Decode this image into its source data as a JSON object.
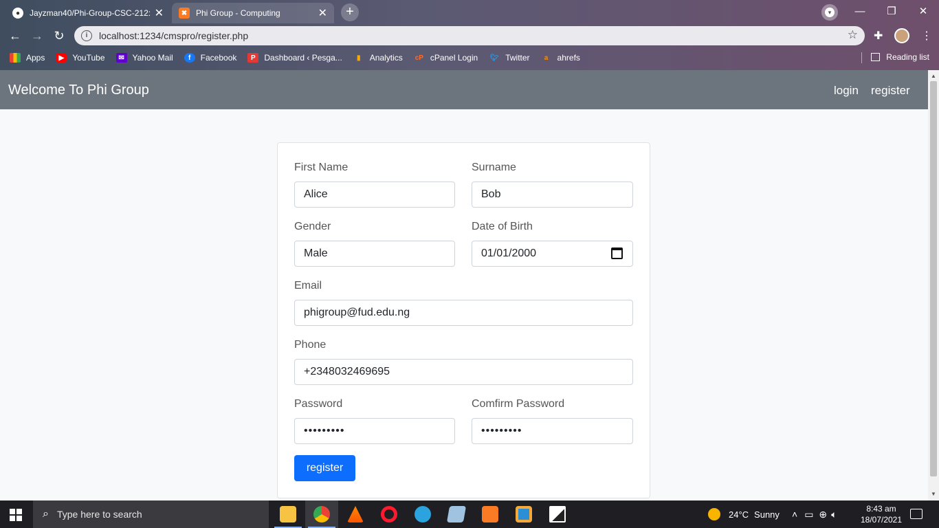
{
  "browser": {
    "tabs": [
      {
        "title": "Jayzman40/Phi-Group-CSC-212:",
        "active": false,
        "icon": "github-icon"
      },
      {
        "title": "Phi Group - Computing",
        "active": true,
        "icon": "xampp-icon"
      }
    ],
    "new_tab_label": "+",
    "url": "localhost:1234/cmspro/register.php",
    "bookmarks": [
      {
        "label": "Apps",
        "icon": "apps-grid-icon",
        "color": "#ea4335"
      },
      {
        "label": "YouTube",
        "icon": "youtube-icon",
        "color": "#ff0000"
      },
      {
        "label": "Yahoo Mail",
        "icon": "yahoo-mail-icon",
        "color": "#6001d2"
      },
      {
        "label": "Facebook",
        "icon": "facebook-icon",
        "color": "#1877f2"
      },
      {
        "label": "Dashboard ‹ Pesga...",
        "icon": "dashboard-p-icon",
        "color": "#e53935"
      },
      {
        "label": "Analytics",
        "icon": "analytics-icon",
        "color": "#f9ab00"
      },
      {
        "label": "cPanel Login",
        "icon": "cpanel-icon",
        "color": "#ff6c2c"
      },
      {
        "label": "Twitter",
        "icon": "twitter-icon",
        "color": "#1da1f2"
      },
      {
        "label": "ahrefs",
        "icon": "ahrefs-icon",
        "color": "#ff8800"
      }
    ],
    "reading_list": "Reading list"
  },
  "navbar": {
    "brand": "Welcome To Phi Group",
    "links": [
      "login",
      "register"
    ]
  },
  "form": {
    "first_name": {
      "label": "First Name",
      "value": "Alice"
    },
    "surname": {
      "label": "Surname",
      "value": "Bob"
    },
    "gender": {
      "label": "Gender",
      "value": "Male"
    },
    "dob": {
      "label": "Date of Birth",
      "value": "01/01/2000"
    },
    "email": {
      "label": "Email",
      "value": "phigroup@fud.edu.ng"
    },
    "phone": {
      "label": "Phone",
      "value": "+2348032469695"
    },
    "password": {
      "label": "Password",
      "value": "•••••••••"
    },
    "confirm_password": {
      "label": "Comfirm Password",
      "value": "•••••••••"
    },
    "submit_label": "register",
    "accent_color": "#0d6efd"
  },
  "taskbar": {
    "search_placeholder": "Type here to search",
    "weather": {
      "temp": "24°C",
      "condition": "Sunny"
    },
    "time": "8:43 am",
    "date": "18/07/2021"
  }
}
